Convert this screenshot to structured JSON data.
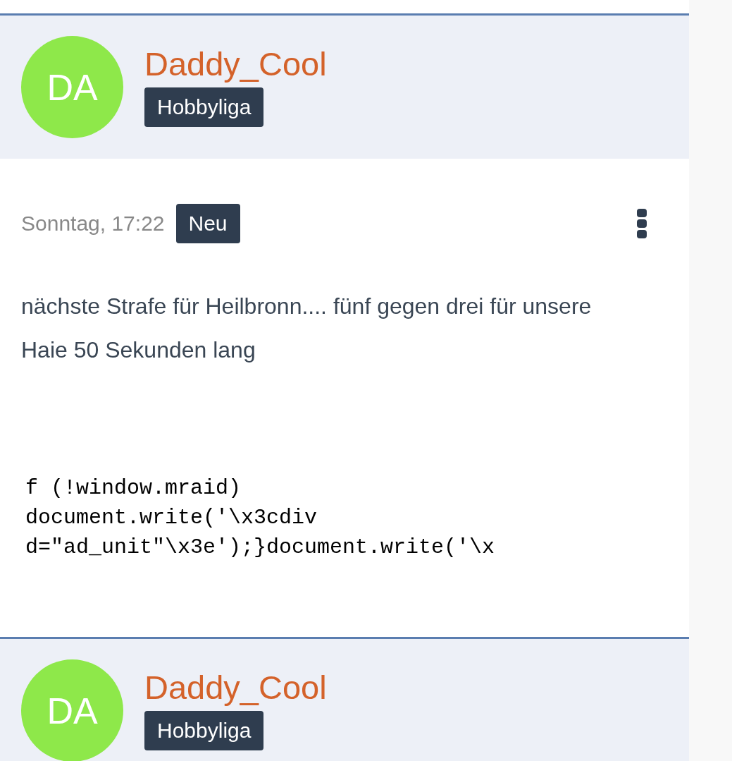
{
  "posts": [
    {
      "author": {
        "initials": "DA",
        "name": "Daddy_Cool",
        "rank": "Hobbyliga"
      },
      "time": "Sonntag, 17:22",
      "badge": "Neu",
      "text": "nächste Strafe für Heilbronn.... fünf gegen drei für unsere Haie 50 Sekunden lang",
      "code_lines": [
        "f (!window.mraid)",
        "document.write('\\x3cdiv",
        "d=\"ad_unit\"\\x3e');}document.write('\\x"
      ]
    },
    {
      "author": {
        "initials": "DA",
        "name": "Daddy_Cool",
        "rank": "Hobbyliga"
      }
    }
  ]
}
